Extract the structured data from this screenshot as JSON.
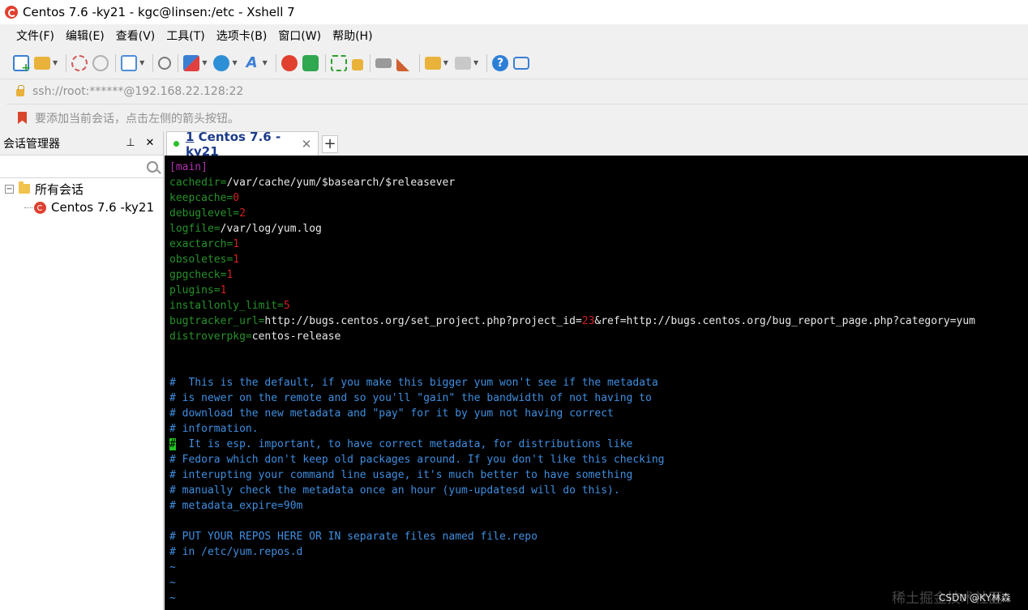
{
  "window": {
    "title": "Centos 7.6 -ky21 - kgc@linsen:/etc - Xshell 7"
  },
  "menu": [
    "文件(F)",
    "编辑(E)",
    "查看(V)",
    "工具(T)",
    "选项卡(B)",
    "窗口(W)",
    "帮助(H)"
  ],
  "address": {
    "value": "ssh://root:******@192.168.22.128:22"
  },
  "hint": {
    "text": "要添加当前会话，点击左侧的箭头按钮。"
  },
  "sidebar": {
    "title": "会话管理器",
    "pin": "ㅁ",
    "close": "✕",
    "search_placeholder": "",
    "tree_toggle": "−",
    "root_label": "所有会话",
    "session_label": "Centos 7.6 -ky21"
  },
  "tab": {
    "number": "1",
    "label": " Centos 7.6 -ky21",
    "close": "✕",
    "newtab": "+"
  },
  "terminal": {
    "main": "[main]",
    "l_cachedir_k": "cachedir=",
    "l_cachedir_v": "/var/cache/yum/$basearch/$releasever",
    "l_keepcache_k": "keepcache=",
    "l_keepcache_v": "0",
    "l_debuglevel_k": "debuglevel=",
    "l_debuglevel_v": "2",
    "l_logfile_k": "logfile=",
    "l_logfile_v": "/var/log/yum.log",
    "l_exactarch_k": "exactarch=",
    "l_exactarch_v": "1",
    "l_obsoletes_k": "obsoletes=",
    "l_obsoletes_v": "1",
    "l_gpgcheck_k": "gpgcheck=",
    "l_gpgcheck_v": "1",
    "l_plugins_k": "plugins=",
    "l_plugins_v": "1",
    "l_instlimit_k": "installonly_limit=",
    "l_instlimit_v": "5",
    "l_bugurl_k": "bugtracker_url=",
    "l_bugurl_v1": "http://bugs.centos.org/set_project.php?project_id=",
    "l_bugurl_num": "23",
    "l_bugurl_v2": "&ref=http://bugs.centos.org/bug_report_page.php?category=yum",
    "l_distro_k": "distroverpkg=",
    "l_distro_v": "centos-release",
    "c1": "#  This is the default, if you make this bigger yum won't see if the metadata",
    "c2": "# is newer on the remote and so you'll \"gain\" the bandwidth of not having to",
    "c3": "# download the new metadata and \"pay\" for it by yum not having correct",
    "c4": "# information.",
    "c5_cursor": "#",
    "c5_rest": "  It is esp. important, to have correct metadata, for distributions like",
    "c6": "# Fedora which don't keep old packages around. If you don't like this checking",
    "c7": "# interupting your command line usage, it's much better to have something",
    "c8": "# manually check the metadata once an hour (yum-updatesd will do this).",
    "c9": "# metadata_expire=90m",
    "c10": "# PUT YOUR REPOS HERE OR IN separate files named file.repo",
    "c11": "# in /etc/yum.repos.d",
    "tilde": "~"
  },
  "watermark": {
    "bg": "稀土掘金技术社区",
    "fg": "CSDN @KY林森"
  }
}
